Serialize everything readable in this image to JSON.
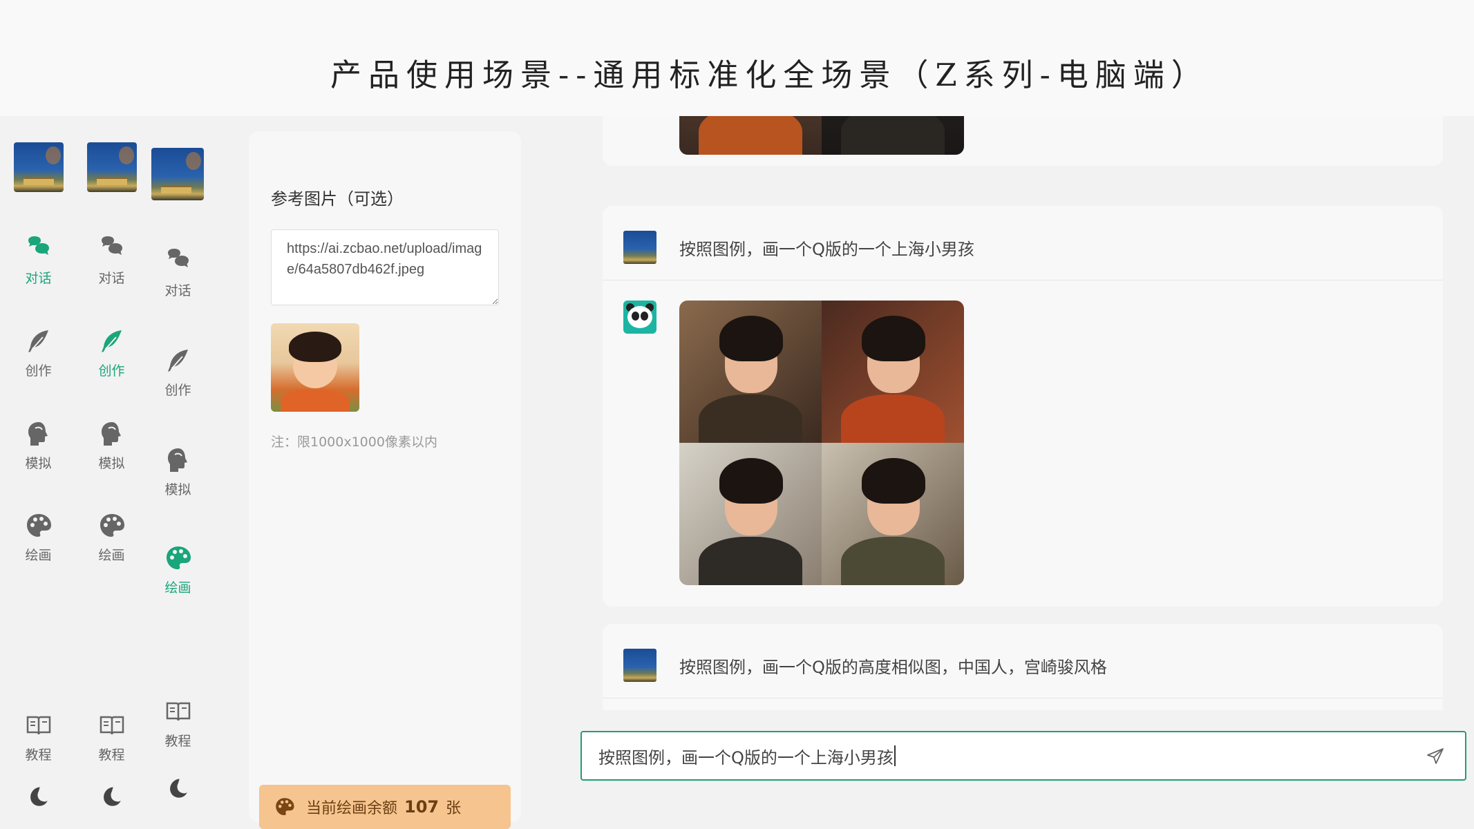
{
  "page_title": "产品使用场景--通用标准化全场景（Z系列-电脑端）",
  "sidebar_columns": [
    {
      "active": "chat",
      "items": {
        "chat": "对话",
        "create": "创作",
        "simulate": "模拟",
        "paint": "绘画",
        "tutorial": "教程"
      }
    },
    {
      "active": "create",
      "items": {
        "chat": "对话",
        "create": "创作",
        "simulate": "模拟",
        "paint": "绘画",
        "tutorial": "教程"
      }
    },
    {
      "active": "paint",
      "items": {
        "chat": "对话",
        "create": "创作",
        "simulate": "模拟",
        "paint": "绘画",
        "tutorial": "教程"
      }
    }
  ],
  "panel": {
    "label": "参考图片（可选）",
    "url_value": "https://ai.zcbao.net/upload/image/64a5807db462f.jpeg",
    "note": "注：限1000x1000像素以内",
    "quota_prefix": "当前绘画余额",
    "quota_value": "107",
    "quota_unit": "张"
  },
  "chat": {
    "messages": [
      {
        "role": "user",
        "text": "按照图例，画一个Q版的一个上海小男孩"
      },
      {
        "role": "user",
        "text": "按照图例，画一个Q版的高度相似图，中国人，宫崎骏风格"
      }
    ]
  },
  "input": {
    "value": "按照图例，画一个Q版的一个上海小男孩"
  },
  "colors": {
    "accent": "#1aa57a",
    "quota_bg": "#f5c48f",
    "input_border": "#1e9e78"
  }
}
